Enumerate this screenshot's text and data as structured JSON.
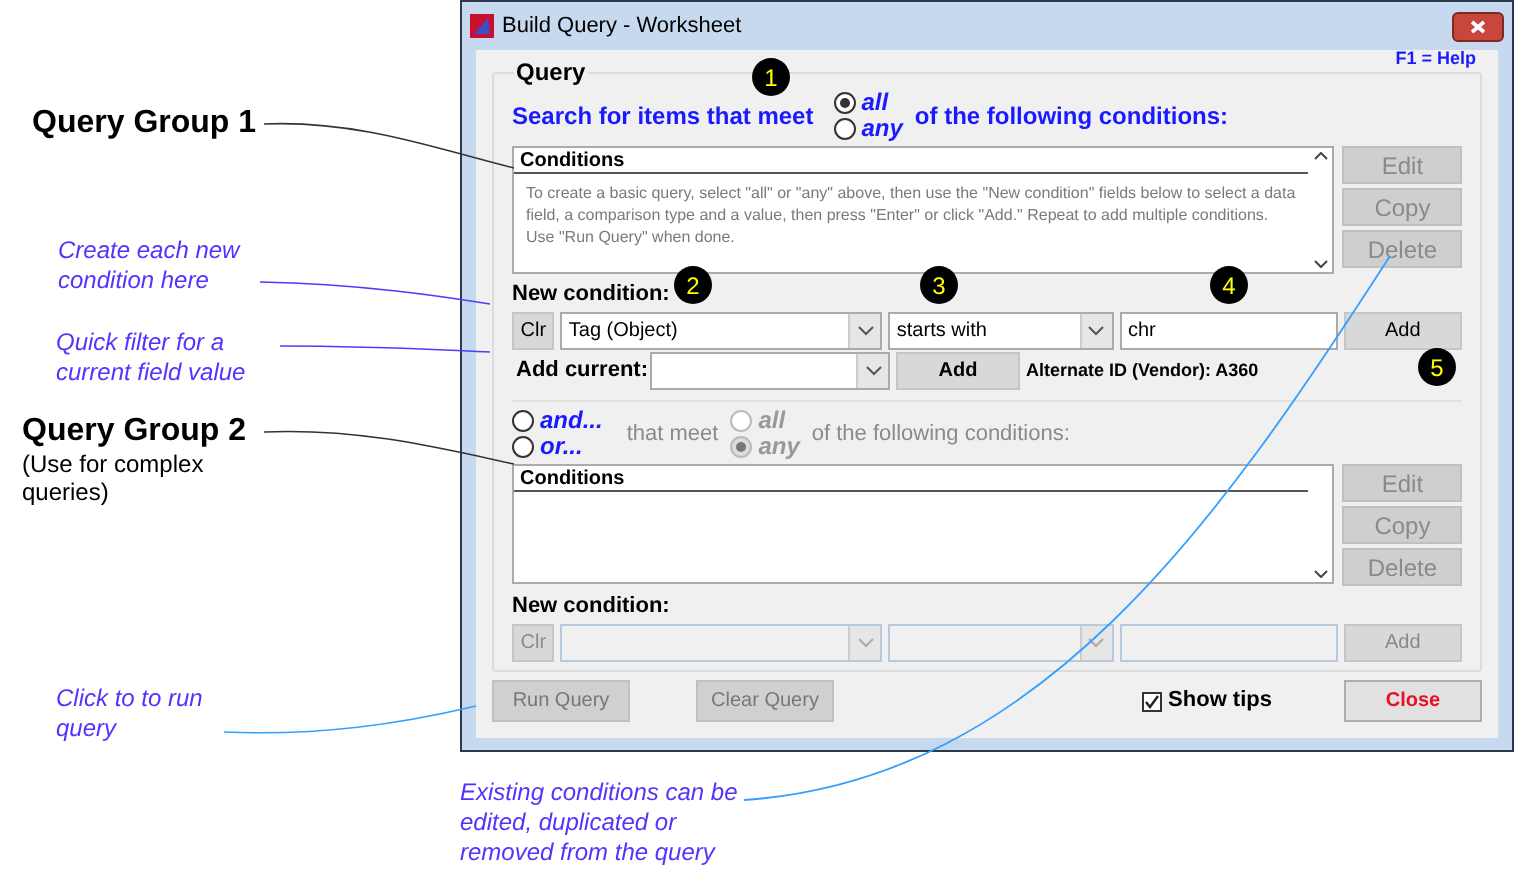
{
  "annotations": [
    {
      "kind": "heading",
      "text": "Query Group 1"
    },
    {
      "kind": "note",
      "text": "Create each new condition here"
    },
    {
      "kind": "note",
      "text": "Quick filter for a current field value"
    },
    {
      "kind": "heading",
      "text": "Query Group 2",
      "subtext": "(Use for complex queries)"
    },
    {
      "kind": "note",
      "text": "Click to to run query"
    },
    {
      "kind": "note",
      "text": "Existing conditions can be edited, duplicated or removed from the query"
    }
  ],
  "badges": [
    "1",
    "2",
    "3",
    "4",
    "5"
  ],
  "window": {
    "title": "Build Query - Worksheet",
    "help": "F1 = Help"
  },
  "group1": {
    "label": "Query",
    "prompt": "Search for items that meet",
    "match": [
      {
        "label": "all",
        "selected": true
      },
      {
        "label": "any",
        "selected": false
      }
    ],
    "suffix": "of the following conditions:",
    "conditions": {
      "header": "Conditions",
      "tip": "To create a basic query, select \"all\" or \"any\" above, then use the \"New condition\" fields below to select a data field, a comparison type and a value, then press \"Enter\" or click \"Add.\"  Repeat to add multiple conditions.  Use \"Run Query\" when done."
    },
    "buttons": [
      {
        "label": "Edit",
        "disabled": true
      },
      {
        "label": "Copy",
        "disabled": true
      },
      {
        "label": "Delete",
        "disabled": true
      }
    ],
    "new_condition": {
      "label": "New condition:",
      "clear": "Clr",
      "field": "Tag (Object)",
      "comparison": "starts with",
      "value": "chr",
      "add": "Add",
      "disabled": false
    },
    "add_current": {
      "label": "Add current:",
      "add": "Add",
      "info": "Alternate ID (Vendor): A360"
    }
  },
  "group2": {
    "join": [
      {
        "label": "and...",
        "selected": false
      },
      {
        "label": "or...",
        "selected": false
      }
    ],
    "prompt": "that meet",
    "match": [
      {
        "label": "all",
        "selected": false
      },
      {
        "label": "any",
        "selected": true
      }
    ],
    "suffix": "of the following conditions:",
    "disabled": true,
    "conditions": {
      "header": "Conditions"
    },
    "buttons": [
      {
        "label": "Edit",
        "disabled": true
      },
      {
        "label": "Copy",
        "disabled": true
      },
      {
        "label": "Delete",
        "disabled": true
      }
    ],
    "new_condition": {
      "label": "New condition:",
      "clear": "Clr",
      "add": "Add",
      "disabled": true
    }
  },
  "footer": {
    "run": {
      "label": "Run Query",
      "disabled": true
    },
    "clear": {
      "label": "Clear Query",
      "disabled": true
    },
    "show_tips": {
      "label": "Show tips",
      "checked": true
    },
    "close": "Close"
  }
}
